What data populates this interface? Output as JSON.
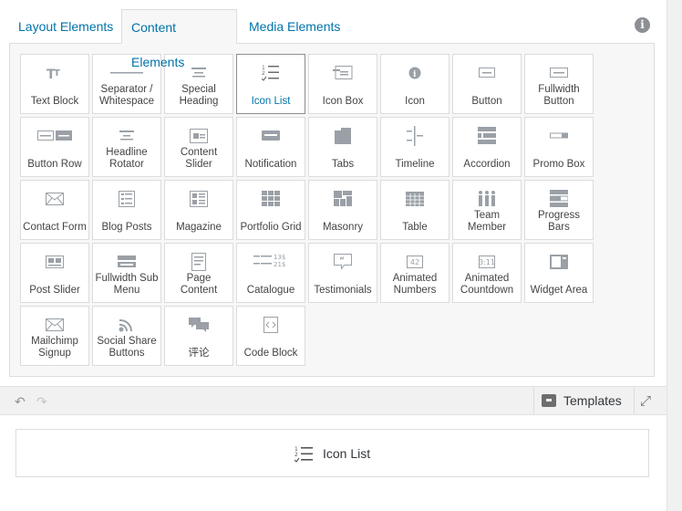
{
  "tabs": [
    {
      "label": "Layout Elements"
    },
    {
      "label": "Content Elements"
    },
    {
      "label": "Media Elements"
    }
  ],
  "info_icon": "info-icon",
  "elements": [
    {
      "label": "Text Block",
      "icon": "text-block-icon"
    },
    {
      "label": "Separator / Whitespace",
      "icon": "separator-icon"
    },
    {
      "label": "Special Heading",
      "icon": "special-heading-icon"
    },
    {
      "label": "Icon List",
      "icon": "icon-list-icon",
      "active": true
    },
    {
      "label": "Icon Box",
      "icon": "icon-box-icon"
    },
    {
      "label": "Icon",
      "icon": "info-circle-icon"
    },
    {
      "label": "Button",
      "icon": "button-icon"
    },
    {
      "label": "Fullwidth Button",
      "icon": "fullwidth-button-icon"
    },
    {
      "label": "Button Row",
      "icon": "button-row-icon"
    },
    {
      "label": "Headline Rotator",
      "icon": "headline-rotator-icon"
    },
    {
      "label": "Content Slider",
      "icon": "content-slider-icon"
    },
    {
      "label": "Notification",
      "icon": "notification-icon"
    },
    {
      "label": "Tabs",
      "icon": "tabs-icon"
    },
    {
      "label": "Timeline",
      "icon": "timeline-icon"
    },
    {
      "label": "Accordion",
      "icon": "accordion-icon"
    },
    {
      "label": "Promo Box",
      "icon": "promo-box-icon"
    },
    {
      "label": "Contact Form",
      "icon": "envelope-icon"
    },
    {
      "label": "Blog Posts",
      "icon": "blog-posts-icon"
    },
    {
      "label": "Magazine",
      "icon": "magazine-icon"
    },
    {
      "label": "Portfolio Grid",
      "icon": "portfolio-grid-icon"
    },
    {
      "label": "Masonry",
      "icon": "masonry-icon"
    },
    {
      "label": "Table",
      "icon": "table-icon"
    },
    {
      "label": "Team Member",
      "icon": "team-member-icon"
    },
    {
      "label": "Progress Bars",
      "icon": "progress-bars-icon"
    },
    {
      "label": "Post Slider",
      "icon": "post-slider-icon"
    },
    {
      "label": "Fullwidth Sub Menu",
      "icon": "sub-menu-icon"
    },
    {
      "label": "Page Content",
      "icon": "page-content-icon"
    },
    {
      "label": "Catalogue",
      "icon": "catalogue-icon"
    },
    {
      "label": "Testimonials",
      "icon": "testimonials-icon"
    },
    {
      "label": "Animated Numbers",
      "icon": "animated-numbers-icon"
    },
    {
      "label": "Animated Countdown",
      "icon": "animated-countdown-icon"
    },
    {
      "label": "Widget Area",
      "icon": "widget-area-icon"
    },
    {
      "label": "Mailchimp Signup",
      "icon": "mailchimp-icon"
    },
    {
      "label": "Social Share Buttons",
      "icon": "social-share-icon"
    },
    {
      "label": "评论",
      "icon": "comments-icon"
    },
    {
      "label": "Code Block",
      "icon": "code-block-icon"
    }
  ],
  "icon_texts": {
    "numbers": "42",
    "countdown": "3:11",
    "catalogue_a": "13$",
    "catalogue_b": "21$"
  },
  "toolbar": {
    "undo_icon": "undo-icon",
    "redo_icon": "redo-icon",
    "templates_label": "Templates",
    "expand_icon": "expand-icon"
  },
  "canvas": {
    "element_label": "Icon List",
    "element_icon": "icon-list-icon"
  }
}
